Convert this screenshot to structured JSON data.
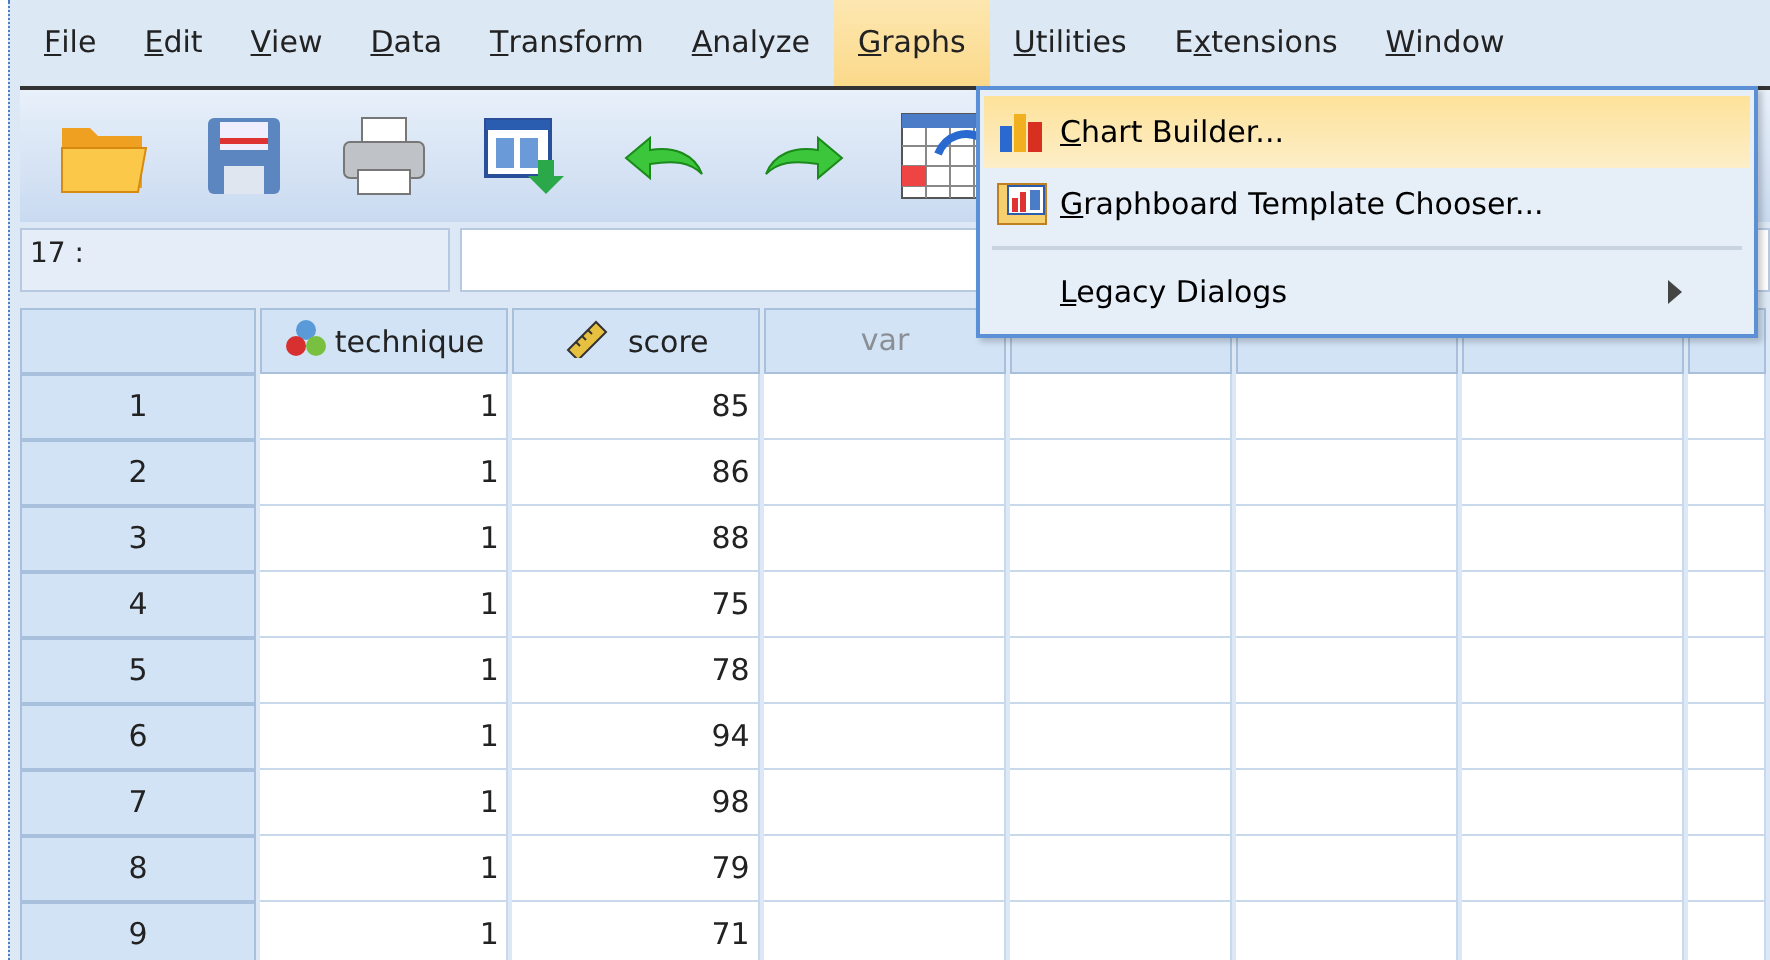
{
  "menu_bar": [
    {
      "access_key": "F",
      "after": "ile",
      "selected": false
    },
    {
      "access_key": "E",
      "after": "dit",
      "selected": false
    },
    {
      "access_key": "V",
      "after": "iew",
      "selected": false
    },
    {
      "access_key": "D",
      "after": "ata",
      "selected": false
    },
    {
      "access_key": "T",
      "after": "ransform",
      "selected": false
    },
    {
      "access_key": "A",
      "after": "nalyze",
      "selected": false
    },
    {
      "access_key": "G",
      "after": "raphs",
      "selected": true
    },
    {
      "access_key": "U",
      "after": "tilities",
      "selected": false
    },
    {
      "before": "E",
      "access_key": "x",
      "after": "tensions",
      "selected": false
    },
    {
      "access_key": "W",
      "after": "indow",
      "selected": false
    }
  ],
  "toolbar": [
    {
      "kind": "open"
    },
    {
      "kind": "save"
    },
    {
      "kind": "print"
    },
    {
      "kind": "recall"
    },
    {
      "kind": "undo"
    },
    {
      "kind": "redo"
    },
    {
      "kind": "goto"
    }
  ],
  "cell_reference": "17 :",
  "graphs_menu": [
    {
      "kind": "item",
      "access_key": "C",
      "after": "hart Builder...",
      "highlighted": true
    },
    {
      "kind": "item",
      "access_key": "G",
      "after": "raphboard Template Chooser...",
      "highlighted": false
    },
    {
      "kind": "separator"
    },
    {
      "kind": "submenu",
      "access_key": "L",
      "after": "egacy Dialogs",
      "highlighted": false
    }
  ],
  "table": {
    "columns": [
      {
        "label": "technique",
        "kind": "nominal"
      },
      {
        "label": "score",
        "kind": "scale"
      },
      {
        "label": "var",
        "kind": "empty"
      },
      {
        "kind": "empty"
      },
      {
        "kind": "empty"
      },
      {
        "kind": "empty"
      },
      {
        "kind": "empty"
      }
    ],
    "rows": [
      {
        "case": "1",
        "cells": [
          "1",
          "85"
        ]
      },
      {
        "case": "2",
        "cells": [
          "1",
          "86"
        ]
      },
      {
        "case": "3",
        "cells": [
          "1",
          "88"
        ]
      },
      {
        "case": "4",
        "cells": [
          "1",
          "75"
        ]
      },
      {
        "case": "5",
        "cells": [
          "1",
          "78"
        ]
      },
      {
        "case": "6",
        "cells": [
          "1",
          "94"
        ]
      },
      {
        "case": "7",
        "cells": [
          "1",
          "98"
        ]
      },
      {
        "case": "8",
        "cells": [
          "1",
          "79"
        ]
      },
      {
        "case": "9",
        "cells": [
          "1",
          "71"
        ]
      }
    ]
  }
}
